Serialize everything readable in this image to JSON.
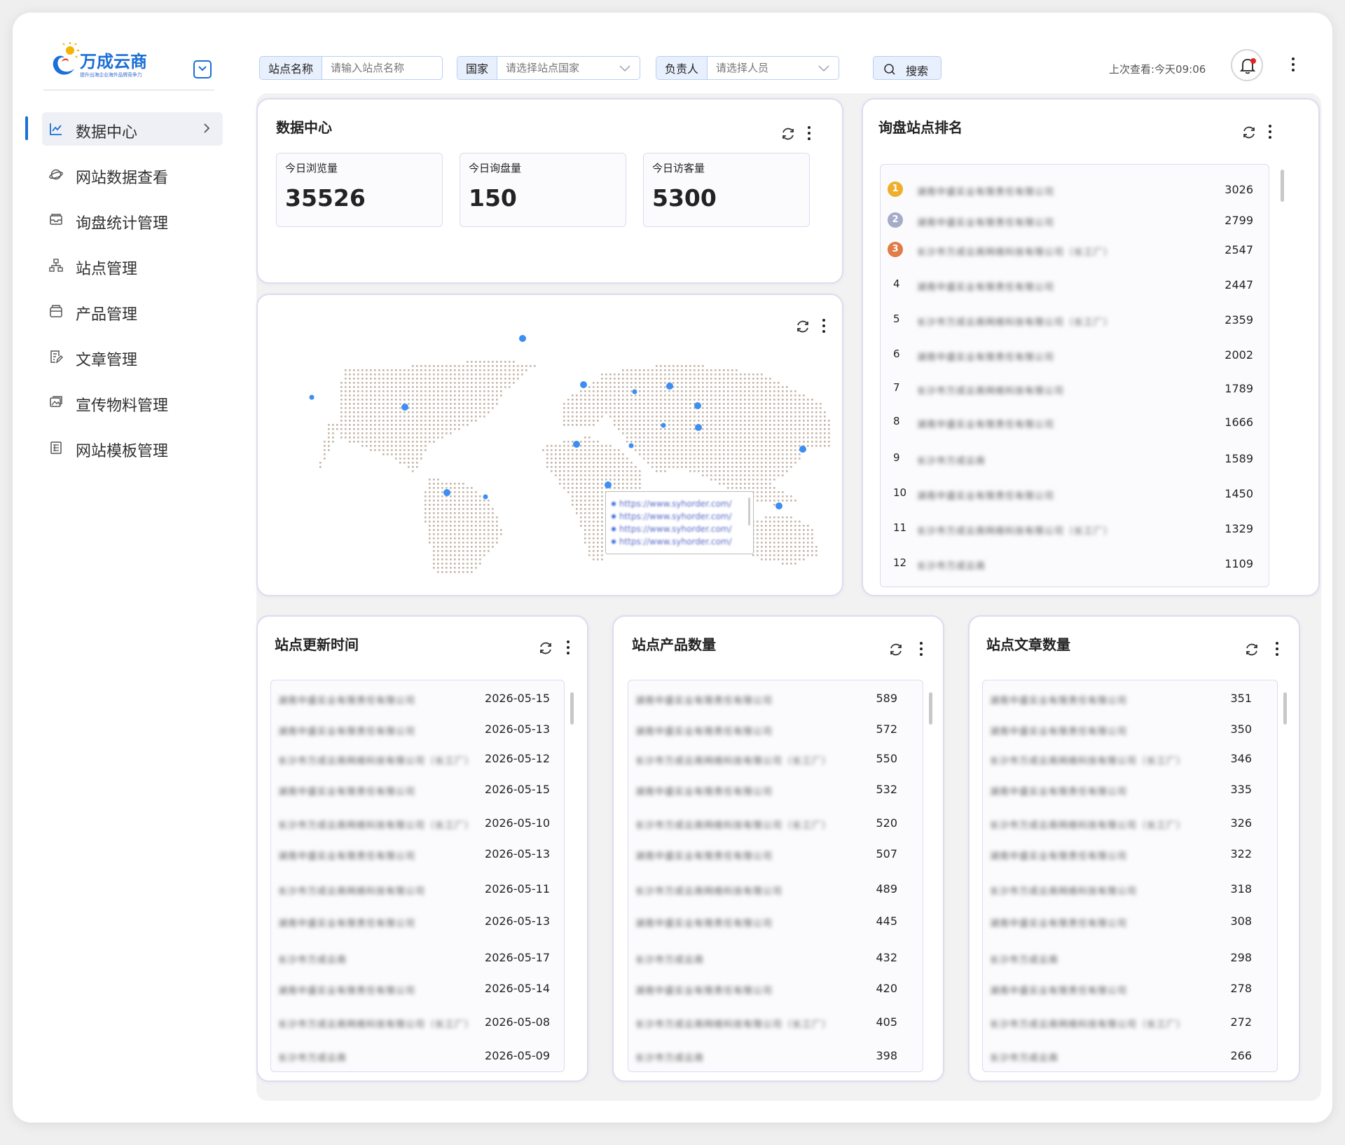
{
  "brand": {
    "name": "万成云商",
    "tagline": "提升出海企业海外品牌竞争力"
  },
  "colors": {
    "accent": "#1b6fd6",
    "map_dots": "#c5b5a6",
    "marker": "#3d8ef2",
    "gold": "#efae2c",
    "silver": "#a4acc8",
    "bronze": "#e07c48"
  },
  "sidebar": {
    "items": [
      {
        "label": "数据中心",
        "icon": "line-chart-icon",
        "active": true
      },
      {
        "label": "网站数据查看",
        "icon": "planet-icon"
      },
      {
        "label": "询盘统计管理",
        "icon": "inbox-icon"
      },
      {
        "label": "站点管理",
        "icon": "sitemap-icon"
      },
      {
        "label": "产品管理",
        "icon": "box-icon"
      },
      {
        "label": "文章管理",
        "icon": "article-icon"
      },
      {
        "label": "宣传物料管理",
        "icon": "image-icon"
      },
      {
        "label": "网站模板管理",
        "icon": "template-icon"
      }
    ]
  },
  "filters": {
    "site": {
      "label": "站点名称",
      "placeholder": "请输入站点名称"
    },
    "country": {
      "label": "国家",
      "placeholder": "请选择站点国家"
    },
    "owner": {
      "label": "负责人",
      "placeholder": "请选择人员"
    },
    "search_label": "搜索"
  },
  "header": {
    "last_view": "上次查看:今天09:06"
  },
  "data_center": {
    "title": "数据中心",
    "stats": [
      {
        "label": "今日浏览量",
        "value": "35526"
      },
      {
        "label": "今日询盘量",
        "value": "150"
      },
      {
        "label": "今日访客量",
        "value": "5300"
      }
    ]
  },
  "map": {
    "tooltip_lines": [
      "https://www.syhorder.com/",
      "https://www.syhorder.com/",
      "https://www.syhorder.com/",
      "https://www.syhorder.com/"
    ]
  },
  "ranking": {
    "title": "询盘站点排名",
    "rows": [
      {
        "rank": "1",
        "name": "湖南中盛实业有限责任有限公司",
        "value": "3026"
      },
      {
        "rank": "2",
        "name": "湖南中盛实业有限责任有限公司",
        "value": "2799"
      },
      {
        "rank": "3",
        "name": "长沙市万成云商网络科技有限公司（长工厂）",
        "value": "2547"
      },
      {
        "rank": "4",
        "name": "湖南中盛实业有限责任有限公司",
        "value": "2447"
      },
      {
        "rank": "5",
        "name": "长沙市万成云商网络科技有限公司（长工厂）",
        "value": "2359"
      },
      {
        "rank": "6",
        "name": "湖南中盛实业有限责任有限公司",
        "value": "2002"
      },
      {
        "rank": "7",
        "name": "长沙市万成云商网络科技有限公司",
        "value": "1789"
      },
      {
        "rank": "8",
        "name": "湖南中盛实业有限责任有限公司",
        "value": "1666"
      },
      {
        "rank": "9",
        "name": "长沙市万成云商",
        "value": "1589"
      },
      {
        "rank": "10",
        "name": "湖南中盛实业有限责任有限公司",
        "value": "1450"
      },
      {
        "rank": "11",
        "name": "长沙市万成云商网络科技有限公司（长工厂）",
        "value": "1329"
      },
      {
        "rank": "12",
        "name": "长沙市万成云商",
        "value": "1109"
      }
    ]
  },
  "updates": {
    "title": "站点更新时间",
    "rows": [
      {
        "name": "湖南中盛实业有限责任有限公司",
        "value": "2026-05-15"
      },
      {
        "name": "湖南中盛实业有限责任有限公司",
        "value": "2026-05-13"
      },
      {
        "name": "长沙市万成云商网络科技有限公司（长工厂）",
        "value": "2026-05-12"
      },
      {
        "name": "湖南中盛实业有限责任有限公司",
        "value": "2026-05-15"
      },
      {
        "name": "长沙市万成云商网络科技有限公司（长工厂）",
        "value": "2026-05-10"
      },
      {
        "name": "湖南中盛实业有限责任有限公司",
        "value": "2026-05-13"
      },
      {
        "name": "长沙市万成云商网络科技有限公司",
        "value": "2026-05-11"
      },
      {
        "name": "湖南中盛实业有限责任有限公司",
        "value": "2026-05-13"
      },
      {
        "name": "长沙市万成云商",
        "value": "2026-05-17"
      },
      {
        "name": "湖南中盛实业有限责任有限公司",
        "value": "2026-05-14"
      },
      {
        "name": "长沙市万成云商网络科技有限公司（长工厂）",
        "value": "2026-05-08"
      },
      {
        "name": "长沙市万成云商",
        "value": "2026-05-09"
      }
    ]
  },
  "products": {
    "title": "站点产品数量",
    "rows": [
      {
        "name": "湖南中盛实业有限责任有限公司",
        "value": "589"
      },
      {
        "name": "湖南中盛实业有限责任有限公司",
        "value": "572"
      },
      {
        "name": "长沙市万成云商网络科技有限公司（长工厂）",
        "value": "550"
      },
      {
        "name": "湖南中盛实业有限责任有限公司",
        "value": "532"
      },
      {
        "name": "长沙市万成云商网络科技有限公司（长工厂）",
        "value": "520"
      },
      {
        "name": "湖南中盛实业有限责任有限公司",
        "value": "507"
      },
      {
        "name": "长沙市万成云商网络科技有限公司",
        "value": "489"
      },
      {
        "name": "湖南中盛实业有限责任有限公司",
        "value": "445"
      },
      {
        "name": "长沙市万成云商",
        "value": "432"
      },
      {
        "name": "湖南中盛实业有限责任有限公司",
        "value": "420"
      },
      {
        "name": "长沙市万成云商网络科技有限公司（长工厂）",
        "value": "405"
      },
      {
        "name": "长沙市万成云商",
        "value": "398"
      }
    ]
  },
  "articles": {
    "title": "站点文章数量",
    "rows": [
      {
        "name": "湖南中盛实业有限责任有限公司",
        "value": "351"
      },
      {
        "name": "湖南中盛实业有限责任有限公司",
        "value": "350"
      },
      {
        "name": "长沙市万成云商网络科技有限公司（长工厂）",
        "value": "346"
      },
      {
        "name": "湖南中盛实业有限责任有限公司",
        "value": "335"
      },
      {
        "name": "长沙市万成云商网络科技有限公司（长工厂）",
        "value": "326"
      },
      {
        "name": "湖南中盛实业有限责任有限公司",
        "value": "322"
      },
      {
        "name": "长沙市万成云商网络科技有限公司",
        "value": "318"
      },
      {
        "name": "湖南中盛实业有限责任有限公司",
        "value": "308"
      },
      {
        "name": "长沙市万成云商",
        "value": "298"
      },
      {
        "name": "湖南中盛实业有限责任有限公司",
        "value": "278"
      },
      {
        "name": "长沙市万成云商网络科技有限公司（长工厂）",
        "value": "272"
      },
      {
        "name": "长沙市万成云商",
        "value": "266"
      }
    ]
  }
}
